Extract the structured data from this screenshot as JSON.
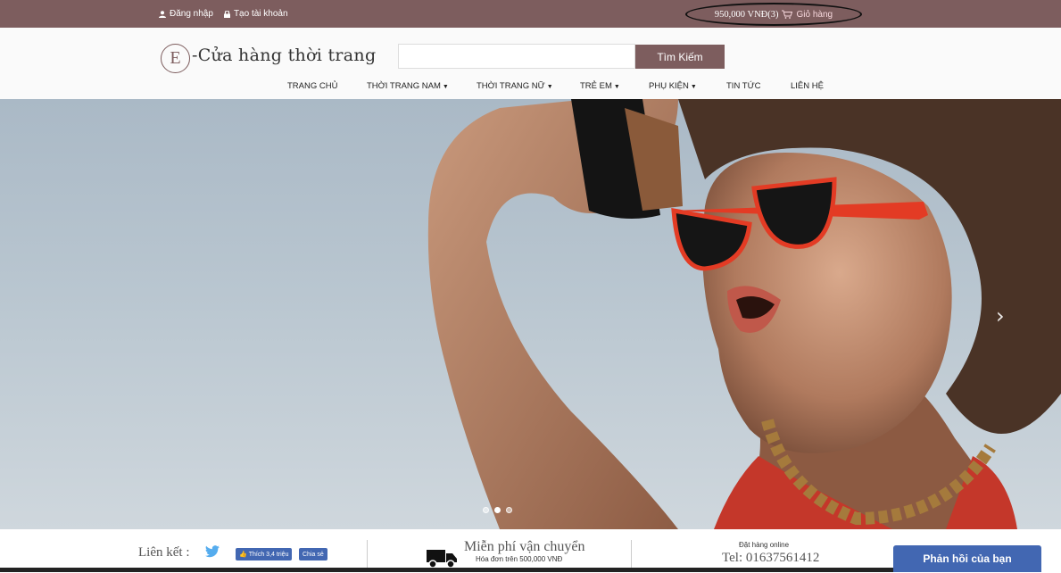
{
  "topbar": {
    "login_label": "Đăng nhập",
    "register_label": "Tạo tài khoản",
    "cart_total": "950,000 VNĐ(3)",
    "cart_label": "Giỏ hàng"
  },
  "header": {
    "logo_letter": "E",
    "logo_text": "-Cửa hàng thời trang",
    "search_placeholder": "",
    "search_button": "Tìm Kiếm"
  },
  "nav": {
    "items": [
      {
        "label": "TRANG CHỦ",
        "dropdown": false
      },
      {
        "label": "THỜI TRANG NAM",
        "dropdown": true
      },
      {
        "label": "THỜI TRANG NỮ",
        "dropdown": true
      },
      {
        "label": "TRẺ EM",
        "dropdown": true
      },
      {
        "label": "PHỤ KIỆN",
        "dropdown": true
      },
      {
        "label": "TIN TỨC",
        "dropdown": false
      },
      {
        "label": "LIÊN HỆ",
        "dropdown": false
      }
    ]
  },
  "slider": {
    "next_icon": "chevron-right-icon",
    "dots": 3,
    "active_dot": 1
  },
  "footer": {
    "links_label": "Liên kết :",
    "fb_like": "Thích 3,4 triệu",
    "fb_share": "Chia sẻ",
    "shipping_title": "Miễn phí vận chuyển",
    "shipping_sub": "Hóa đơn trên 500,000 VNĐ",
    "order_label": "Đặt hàng online",
    "tel": "Tel: 01637561412",
    "feedback": "Phản hồi của bạn"
  },
  "colors": {
    "brand": "#7d5d5e",
    "facebook": "#4267b2",
    "twitter": "#55acee"
  }
}
